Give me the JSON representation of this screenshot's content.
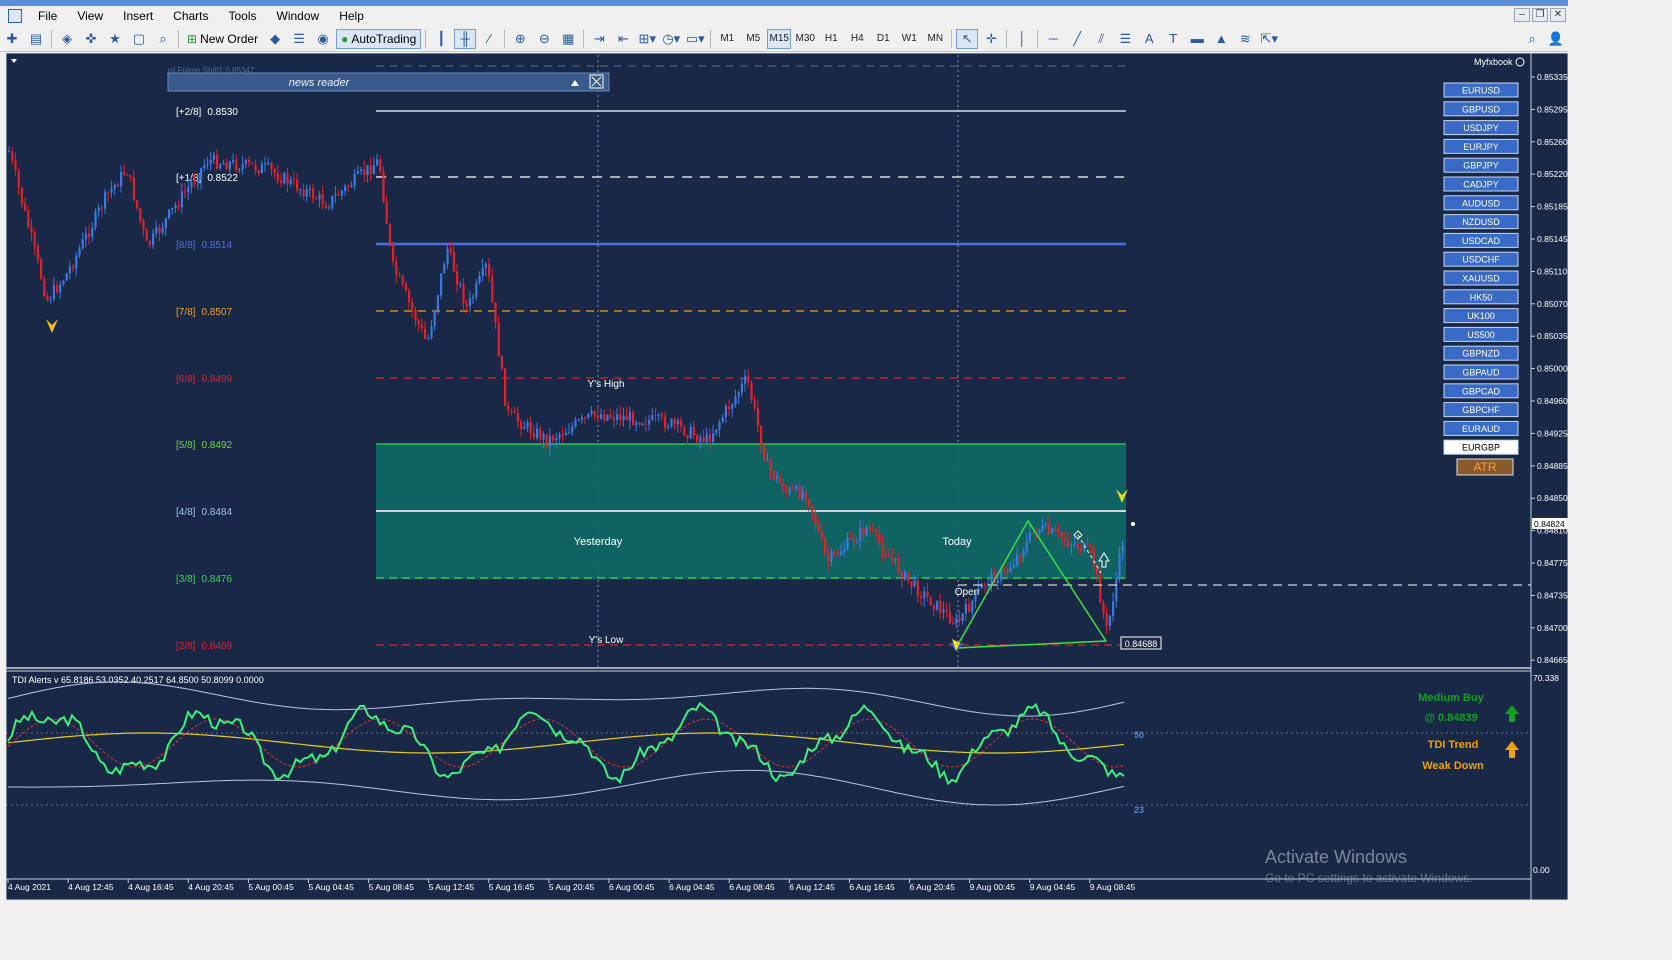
{
  "menu": [
    "File",
    "View",
    "Insert",
    "Charts",
    "Tools",
    "Window",
    "Help"
  ],
  "toolbar": {
    "new_order": "New Order",
    "autotrading": "AutoTrading",
    "timeframes": [
      "M1",
      "M5",
      "M15",
      "M30",
      "H1",
      "H4",
      "D1",
      "W1",
      "MN"
    ],
    "active_tf": "M15"
  },
  "chart": {
    "panel_label": "news reader",
    "faded_label": "rd Frame Shift1  0.85347",
    "myfxbook": "Myfxbook",
    "price_axis": [
      "0.85335",
      "0.85295",
      "0.85260",
      "0.85220",
      "0.85185",
      "0.85145",
      "0.85110",
      "0.85070",
      "0.85035",
      "0.85000",
      "0.84960",
      "0.84925",
      "0.84885",
      "0.84850",
      "0.84810",
      "0.84775",
      "0.84735",
      "0.84700",
      "0.84665"
    ],
    "current_price": "0.84824",
    "low_price": "0.84688",
    "murrey": [
      {
        "label": "[+2/8]",
        "value": "0.8530",
        "color": "#ffffff"
      },
      {
        "label": "[+1/8]",
        "value": "0.8522",
        "color": "#ffffff"
      },
      {
        "label": "[8/8]",
        "value": "0.8514",
        "color": "#4a6fe0"
      },
      {
        "label": "[7/8]",
        "value": "0.8507",
        "color": "#f0a020"
      },
      {
        "label": "[6/8]",
        "value": "0.8499",
        "color": "#e0202a"
      },
      {
        "label": "[5/8]",
        "value": "0.8492",
        "color": "#6ed830"
      },
      {
        "label": "[4/8]",
        "value": "0.8484",
        "color": "#9fc4e8"
      },
      {
        "label": "[3/8]",
        "value": "0.8476",
        "color": "#30d850"
      },
      {
        "label": "[2/8]",
        "value": "0.8469",
        "color": "#e0202a"
      }
    ],
    "annotations": {
      "y_high": "Y's High",
      "y_low": "Y's Low",
      "yesterday": "Yesterday",
      "today": "Today",
      "open": "Open"
    },
    "symbols": [
      "EURUSD",
      "GBPUSD",
      "USDJPY",
      "EURJPY",
      "GBPJPY",
      "CADJPY",
      "AUDUSD",
      "NZDUSD",
      "USDCAD",
      "USDCHF",
      "XAUUSD",
      "HK50",
      "UK100",
      "US500",
      "GBPNZD",
      "GBPAUD",
      "GBPCAD",
      "GBPCHF",
      "EURAUD",
      "EURGBP"
    ],
    "active_symbol": "EURGBP",
    "atr": "ATR",
    "time_axis": [
      "4 Aug 2021",
      "4 Aug 12:45",
      "4 Aug 16:45",
      "4 Aug 20:45",
      "5 Aug 00:45",
      "5 Aug 04:45",
      "5 Aug 08:45",
      "5 Aug 12:45",
      "5 Aug 16:45",
      "5 Aug 20:45",
      "6 Aug 00:45",
      "6 Aug 04:45",
      "6 Aug 08:45",
      "6 Aug 12:45",
      "6 Aug 16:45",
      "6 Aug 20:45",
      "9 Aug 00:45",
      "9 Aug 04:45",
      "9 Aug 08:45"
    ]
  },
  "indicator": {
    "title": "TDI Alerts v 65.8186 53.0352 40.2517 64.8500 50.8099 0.0000",
    "signal1": "Medium Buy",
    "signal2": "@ 0.84839",
    "signal3": "TDI Trend",
    "signal4": "Weak Down",
    "axis_top": "70.338",
    "level50": "50",
    "level23": "23",
    "axis_bottom": "0.00"
  },
  "watermark": {
    "line1": "Activate Windows",
    "line2": "Go to PC settings to activate Windows."
  },
  "colors": {
    "bg": "#192846",
    "bull": "#3b78e0",
    "bear": "#e0202a",
    "box": "#0e6a66",
    "tdi": "#3cf07a",
    "symbol_btn": "#3a6ac8"
  }
}
